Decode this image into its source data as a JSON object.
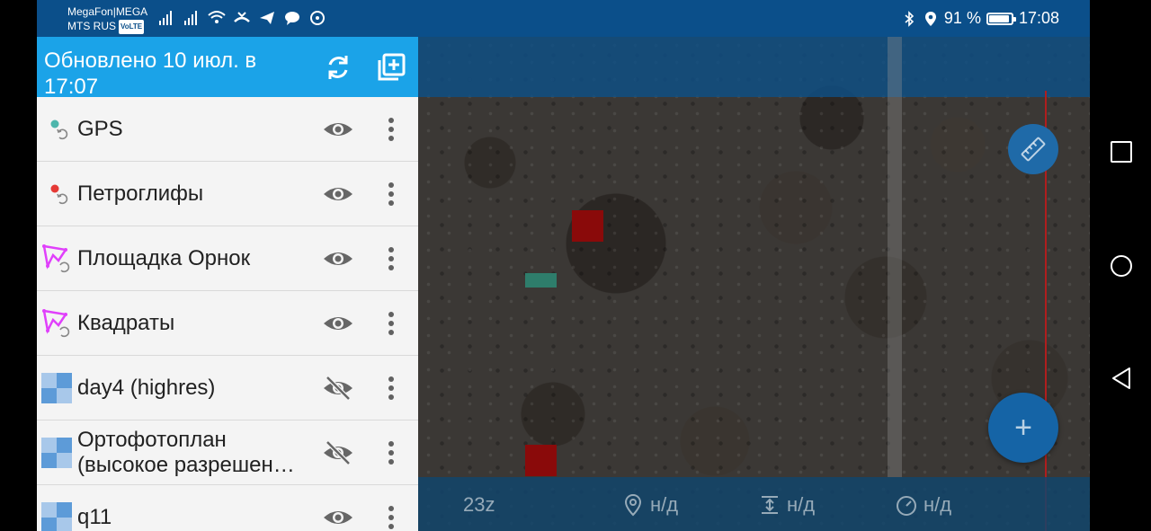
{
  "status_bar": {
    "carrier_line1": "MegaFon|MEGA",
    "carrier_line2": "MTS RUS",
    "volte": "VoLTE",
    "battery_percent_text": "91 %",
    "battery_level": 0.91,
    "time": "17:08"
  },
  "panel": {
    "title": "Обновлено 10 июл. в 17:07",
    "refresh_icon": "refresh-icon",
    "add_layer_icon": "add-layer-icon",
    "accent_color": "#1ba3e8",
    "layers": [
      {
        "name": "GPS",
        "icon": "point-layer-icon",
        "icon_color": "#4db6ac",
        "visible": true
      },
      {
        "name": "Петроглифы",
        "icon": "point-layer-icon",
        "icon_color": "#e53935",
        "visible": true
      },
      {
        "name": "Площадка Орнок",
        "icon": "polygon-layer-icon",
        "icon_color": "#e040fb",
        "visible": true
      },
      {
        "name": "Квадраты",
        "icon": "polygon-layer-icon",
        "icon_color": "#e040fb",
        "visible": true
      },
      {
        "name": "day4 (highres)",
        "icon": "raster-layer-icon",
        "visible": false
      },
      {
        "name": "Ортофотоплан (высокое разрешен…",
        "icon": "raster-layer-icon",
        "visible": false
      },
      {
        "name": "q11",
        "icon": "raster-layer-icon",
        "visible": true
      }
    ]
  },
  "map": {
    "zoom": "23z",
    "coords": "н/д",
    "altitude": "н/д",
    "speed": "н/д",
    "ruler_icon": "ruler-icon",
    "fab_label": "+"
  }
}
